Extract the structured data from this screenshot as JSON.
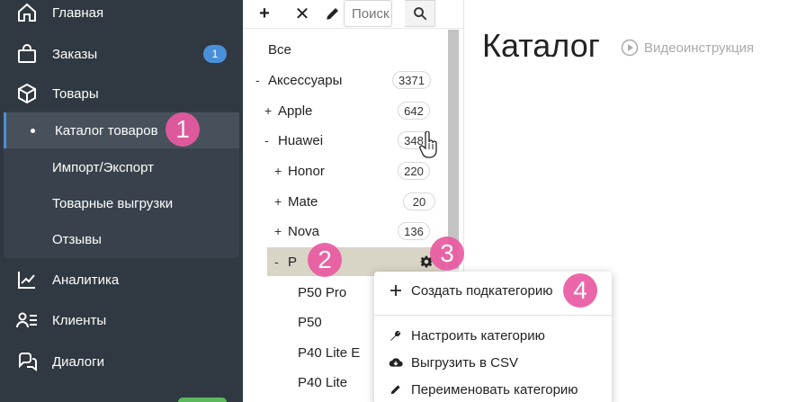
{
  "sidebar": {
    "items": [
      {
        "label": "Главная",
        "icon": "home-icon"
      },
      {
        "label": "Заказы",
        "icon": "shopping-bag-icon",
        "badge": "1"
      },
      {
        "label": "Товары",
        "icon": "box-icon"
      },
      {
        "label": "Аналитика",
        "icon": "chart-line-icon"
      },
      {
        "label": "Клиенты",
        "icon": "users-list-icon"
      },
      {
        "label": "Диалоги",
        "icon": "chat-bubbles-icon"
      }
    ],
    "sub_items": [
      {
        "label": "Каталог товаров",
        "active": true
      },
      {
        "label": "Импорт/Экспорт"
      },
      {
        "label": "Товарные выгрузки"
      },
      {
        "label": "Отзывы"
      }
    ]
  },
  "toolbar": {
    "add": "+",
    "delete": "✕",
    "edit_icon": "pencil-icon",
    "search_placeholder": "Поиск",
    "search_icon": "search-icon"
  },
  "tree": {
    "all_label": "Все",
    "rows": [
      {
        "toggle": "-",
        "label": "Аксессуары",
        "count": "3371"
      },
      {
        "toggle": "+",
        "label": "Apple",
        "count": "642"
      },
      {
        "toggle": "-",
        "label": "Huawei",
        "count": "348"
      },
      {
        "toggle": "+",
        "label": "Honor",
        "count": "220"
      },
      {
        "toggle": "+",
        "label": "Mate",
        "count": "20"
      },
      {
        "toggle": "+",
        "label": "Nova",
        "count": "136"
      },
      {
        "toggle": "-",
        "label": "P",
        "count": ""
      },
      {
        "toggle": "",
        "label": "P50 Pro",
        "count": ""
      },
      {
        "toggle": "",
        "label": "P50",
        "count": ""
      },
      {
        "toggle": "",
        "label": "P40 Lite E",
        "count": ""
      },
      {
        "toggle": "",
        "label": "P40 Lite",
        "count": ""
      }
    ]
  },
  "context_menu": {
    "items": [
      {
        "label": "Создать подкатегорию",
        "icon": "plus-icon"
      },
      {
        "label": "Настроить категорию",
        "icon": "wrench-icon"
      },
      {
        "label": "Выгрузить в CSV",
        "icon": "cloud-download-icon"
      },
      {
        "label": "Переименовать категорию",
        "icon": "pencil-icon"
      }
    ]
  },
  "main": {
    "title": "Каталог",
    "video_label": "Видеоинструкция"
  },
  "markers": [
    "1",
    "2",
    "3",
    "4"
  ],
  "colors": {
    "sidebar_bg": "#303841",
    "accent": "#4a90d9",
    "marker": "#ea5aa2",
    "selected_row": "#d8d4c6"
  }
}
